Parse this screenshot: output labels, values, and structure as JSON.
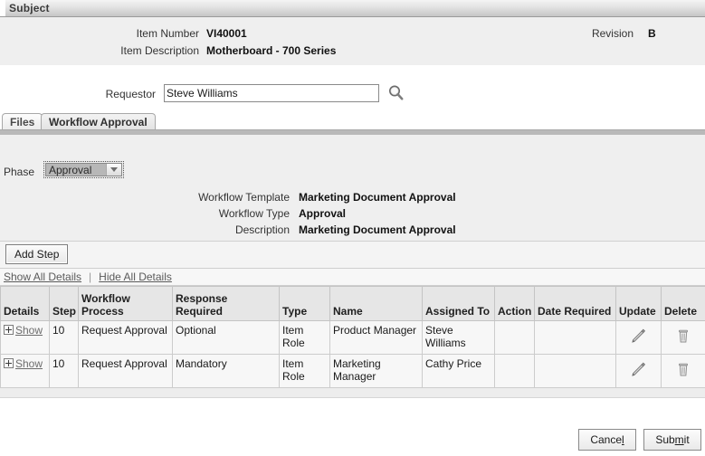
{
  "header": {
    "subject_title": "Subject",
    "item_number_label": "Item Number",
    "item_number_value": "VI40001",
    "item_description_label": "Item Description",
    "item_description_value": "Motherboard - 700 Series",
    "revision_label": "Revision",
    "revision_value": "B"
  },
  "requestor": {
    "label": "Requestor",
    "value": "Steve Williams",
    "placeholder": "",
    "search_icon": "search-icon"
  },
  "tabs": [
    {
      "label": "Files",
      "active": false
    },
    {
      "label": "Workflow Approval",
      "active": true
    }
  ],
  "panel": {
    "phase_label": "Phase",
    "phase_value": "Approval",
    "phase_options": [
      "Approval"
    ],
    "fields": [
      {
        "label": "Workflow Template",
        "value": "Marketing Document Approval"
      },
      {
        "label": "Workflow Type",
        "value": "Approval"
      },
      {
        "label": "Description",
        "value": "Marketing Document Approval"
      }
    ]
  },
  "toolbar": {
    "add_step_label": "Add Step",
    "show_all_details_label": "Show All Details",
    "separator": "|",
    "hide_all_details_label": "Hide All Details"
  },
  "table": {
    "columns": [
      "Details",
      "Step",
      "Workflow Process",
      "Response Required",
      "Type",
      "Name",
      "Assigned To",
      "Action",
      "Date Required",
      "Update",
      "Delete"
    ],
    "row_expand_label": "Show",
    "rows": [
      {
        "details": "Show",
        "step": "10",
        "workflow_process": "Request Approval",
        "response_required": "Optional",
        "type": "Item Role",
        "name": "Product Manager",
        "assigned_to": "Steve Williams",
        "action": "",
        "date_required": "",
        "update_icon": "pencil-icon",
        "delete_icon": "trash-icon"
      },
      {
        "details": "Show",
        "step": "10",
        "workflow_process": "Request Approval",
        "response_required": "Mandatory",
        "type": "Item Role",
        "name": "Marketing Manager",
        "assigned_to": "Cathy Price",
        "action": "",
        "date_required": "",
        "update_icon": "pencil-icon",
        "delete_icon": "trash-icon"
      }
    ]
  },
  "footer": {
    "cancel_label": "Cance",
    "cancel_accel": "l",
    "submit_label_a": "Sub",
    "submit_accel": "m",
    "submit_label_b": "it"
  },
  "colors": {
    "panel_bg": "#efefef",
    "table_header_bg": "#e6e6e6",
    "table_row_bg": "#f7f7f7",
    "link": "#6d6d6d",
    "selection": "#b7b7b7"
  }
}
